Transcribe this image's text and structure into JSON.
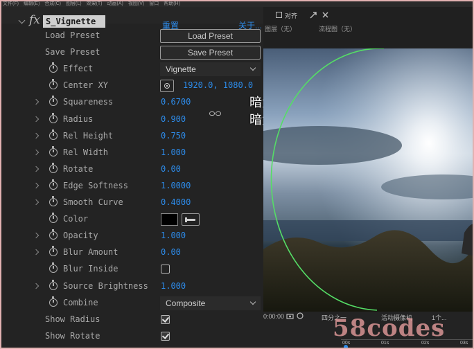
{
  "menubar": [
    "文件(F)",
    "编辑(E)",
    "合成(C)",
    "图层(L)",
    "效果(T)",
    "动画(A)",
    "视图(V)",
    "窗口",
    "帮助(H)"
  ],
  "effect": {
    "fx_glyph": "fx",
    "name": "S_Vignette",
    "reset_label": "重置",
    "about_label": "关于..."
  },
  "params": [
    {
      "id": "load-preset",
      "label": "Load Preset",
      "kind": "button",
      "value": "Load Preset",
      "stopwatch": false,
      "expand": false
    },
    {
      "id": "save-preset",
      "label": "Save Preset",
      "kind": "button",
      "value": "Save Preset",
      "stopwatch": false,
      "expand": false
    },
    {
      "id": "effect",
      "label": "Effect",
      "kind": "dropdown",
      "value": "Vignette",
      "stopwatch": true,
      "expand": false
    },
    {
      "id": "center-xy",
      "label": "Center XY",
      "kind": "point",
      "value": "1920.0, 1080.0",
      "stopwatch": true,
      "expand": false
    },
    {
      "id": "squareness",
      "label": "Squareness",
      "kind": "number",
      "value": "0.6700",
      "stopwatch": true,
      "expand": true
    },
    {
      "id": "radius",
      "label": "Radius",
      "kind": "number",
      "value": "0.900",
      "stopwatch": true,
      "expand": true
    },
    {
      "id": "rel-height",
      "label": "Rel Height",
      "kind": "number",
      "value": "0.750",
      "stopwatch": true,
      "expand": true
    },
    {
      "id": "rel-width",
      "label": "Rel Width",
      "kind": "number",
      "value": "1.000",
      "stopwatch": true,
      "expand": true
    },
    {
      "id": "rotate",
      "label": "Rotate",
      "kind": "number",
      "value": "0.00",
      "stopwatch": true,
      "expand": true
    },
    {
      "id": "edge-softness",
      "label": "Edge Softness",
      "kind": "number",
      "value": "1.0000",
      "stopwatch": true,
      "expand": true
    },
    {
      "id": "smooth-curve",
      "label": "Smooth Curve",
      "kind": "number",
      "value": "0.4000",
      "stopwatch": true,
      "expand": true
    },
    {
      "id": "color",
      "label": "Color",
      "kind": "color",
      "value": "#000000",
      "stopwatch": true,
      "expand": false
    },
    {
      "id": "opacity",
      "label": "Opacity",
      "kind": "number",
      "value": "1.000",
      "stopwatch": true,
      "expand": true
    },
    {
      "id": "blur-amount",
      "label": "Blur Amount",
      "kind": "number",
      "value": "0.00",
      "stopwatch": true,
      "expand": true
    },
    {
      "id": "blur-inside",
      "label": "Blur Inside",
      "kind": "checkbox",
      "value": false,
      "stopwatch": true,
      "expand": false
    },
    {
      "id": "source-brightness",
      "label": "Source Brightness",
      "kind": "number",
      "value": "1.000",
      "stopwatch": true,
      "expand": true
    },
    {
      "id": "combine",
      "label": "Combine",
      "kind": "dropdown",
      "value": "Composite",
      "stopwatch": true,
      "expand": false
    },
    {
      "id": "show-radius",
      "label": "Show Radius",
      "kind": "checkbox",
      "value": true,
      "stopwatch": false,
      "expand": false
    },
    {
      "id": "show-rotate",
      "label": "Show Rotate",
      "kind": "checkbox",
      "value": true,
      "stopwatch": false,
      "expand": false
    }
  ],
  "annotations": [
    "暗角亮度",
    "暗角大小"
  ],
  "viewer": {
    "snap_label": "对齐",
    "layer_label": "图层（无）",
    "flowchart_label": "流程图（无）",
    "timecode": "0:00:00",
    "resolution": "四分之一",
    "camera": "活动摄像机",
    "views": "1个...",
    "ruler": [
      "00s",
      "01s",
      "02s",
      "03s"
    ],
    "accent": "#2d8ceb",
    "radius_circle_color": "#55dd66"
  },
  "watermark": "58codes"
}
